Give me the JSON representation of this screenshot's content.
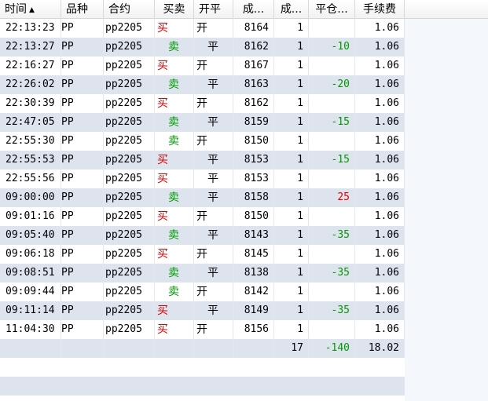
{
  "columns": [
    {
      "key": "time",
      "label": "时间",
      "sort": "▲"
    },
    {
      "key": "product",
      "label": "品种"
    },
    {
      "key": "contract",
      "label": "合约"
    },
    {
      "key": "side",
      "label": "买卖"
    },
    {
      "key": "open_close",
      "label": "开平"
    },
    {
      "key": "price",
      "label": "成..."
    },
    {
      "key": "volume",
      "label": "成..."
    },
    {
      "key": "close_pnl",
      "label": "平仓..."
    },
    {
      "key": "fee",
      "label": "手续费"
    }
  ],
  "rows": [
    {
      "time": "22:13:23",
      "product": "PP",
      "contract": "pp2205",
      "side": "买",
      "side_type": "buy",
      "open_close": "开",
      "oc_type": "open",
      "price": "8164",
      "volume": "1",
      "close_pnl": "",
      "pnl_type": "",
      "fee": "1.06"
    },
    {
      "time": "22:13:27",
      "product": "PP",
      "contract": "pp2205",
      "side": "卖",
      "side_type": "sell",
      "open_close": "平",
      "oc_type": "close",
      "price": "8162",
      "volume": "1",
      "close_pnl": "-10",
      "pnl_type": "neg",
      "fee": "1.06"
    },
    {
      "time": "22:16:27",
      "product": "PP",
      "contract": "pp2205",
      "side": "买",
      "side_type": "buy",
      "open_close": "开",
      "oc_type": "open",
      "price": "8167",
      "volume": "1",
      "close_pnl": "",
      "pnl_type": "",
      "fee": "1.06"
    },
    {
      "time": "22:26:02",
      "product": "PP",
      "contract": "pp2205",
      "side": "卖",
      "side_type": "sell",
      "open_close": "平",
      "oc_type": "close",
      "price": "8163",
      "volume": "1",
      "close_pnl": "-20",
      "pnl_type": "neg",
      "fee": "1.06"
    },
    {
      "time": "22:30:39",
      "product": "PP",
      "contract": "pp2205",
      "side": "买",
      "side_type": "buy",
      "open_close": "开",
      "oc_type": "open",
      "price": "8162",
      "volume": "1",
      "close_pnl": "",
      "pnl_type": "",
      "fee": "1.06"
    },
    {
      "time": "22:47:05",
      "product": "PP",
      "contract": "pp2205",
      "side": "卖",
      "side_type": "sell",
      "open_close": "平",
      "oc_type": "close",
      "price": "8159",
      "volume": "1",
      "close_pnl": "-15",
      "pnl_type": "neg",
      "fee": "1.06"
    },
    {
      "time": "22:55:30",
      "product": "PP",
      "contract": "pp2205",
      "side": "卖",
      "side_type": "sell",
      "open_close": "开",
      "oc_type": "open",
      "price": "8150",
      "volume": "1",
      "close_pnl": "",
      "pnl_type": "",
      "fee": "1.06"
    },
    {
      "time": "22:55:53",
      "product": "PP",
      "contract": "pp2205",
      "side": "买",
      "side_type": "buy",
      "open_close": "平",
      "oc_type": "close",
      "price": "8153",
      "volume": "1",
      "close_pnl": "-15",
      "pnl_type": "neg",
      "fee": "1.06"
    },
    {
      "time": "22:55:56",
      "product": "PP",
      "contract": "pp2205",
      "side": "买",
      "side_type": "buy",
      "open_close": "平",
      "oc_type": "close",
      "price": "8153",
      "volume": "1",
      "close_pnl": "",
      "pnl_type": "",
      "fee": "1.06"
    },
    {
      "time": "09:00:00",
      "product": "PP",
      "contract": "pp2205",
      "side": "卖",
      "side_type": "sell",
      "open_close": "平",
      "oc_type": "close",
      "price": "8158",
      "volume": "1",
      "close_pnl": "25",
      "pnl_type": "pos",
      "fee": "1.06"
    },
    {
      "time": "09:01:16",
      "product": "PP",
      "contract": "pp2205",
      "side": "买",
      "side_type": "buy",
      "open_close": "开",
      "oc_type": "open",
      "price": "8150",
      "volume": "1",
      "close_pnl": "",
      "pnl_type": "",
      "fee": "1.06"
    },
    {
      "time": "09:05:40",
      "product": "PP",
      "contract": "pp2205",
      "side": "卖",
      "side_type": "sell",
      "open_close": "平",
      "oc_type": "close",
      "price": "8143",
      "volume": "1",
      "close_pnl": "-35",
      "pnl_type": "neg",
      "fee": "1.06"
    },
    {
      "time": "09:06:18",
      "product": "PP",
      "contract": "pp2205",
      "side": "买",
      "side_type": "buy",
      "open_close": "开",
      "oc_type": "open",
      "price": "8145",
      "volume": "1",
      "close_pnl": "",
      "pnl_type": "",
      "fee": "1.06"
    },
    {
      "time": "09:08:51",
      "product": "PP",
      "contract": "pp2205",
      "side": "卖",
      "side_type": "sell",
      "open_close": "平",
      "oc_type": "close",
      "price": "8138",
      "volume": "1",
      "close_pnl": "-35",
      "pnl_type": "neg",
      "fee": "1.06"
    },
    {
      "time": "09:09:44",
      "product": "PP",
      "contract": "pp2205",
      "side": "卖",
      "side_type": "sell",
      "open_close": "开",
      "oc_type": "open",
      "price": "8142",
      "volume": "1",
      "close_pnl": "",
      "pnl_type": "",
      "fee": "1.06"
    },
    {
      "time": "09:11:14",
      "product": "PP",
      "contract": "pp2205",
      "side": "买",
      "side_type": "buy",
      "open_close": "平",
      "oc_type": "close",
      "price": "8149",
      "volume": "1",
      "close_pnl": "-35",
      "pnl_type": "neg",
      "fee": "1.06"
    },
    {
      "time": "11:04:30",
      "product": "PP",
      "contract": "pp2205",
      "side": "买",
      "side_type": "buy",
      "open_close": "开",
      "oc_type": "open",
      "price": "8156",
      "volume": "1",
      "close_pnl": "",
      "pnl_type": "",
      "fee": "1.06"
    }
  ],
  "totals": {
    "volume": "17",
    "close_pnl": "-140",
    "fee": "18.02"
  },
  "colors": {
    "buy": "#e00000",
    "sell": "#009a00",
    "profit": "#e00000",
    "loss": "#009a00",
    "row_alt": "#dee4ee"
  }
}
